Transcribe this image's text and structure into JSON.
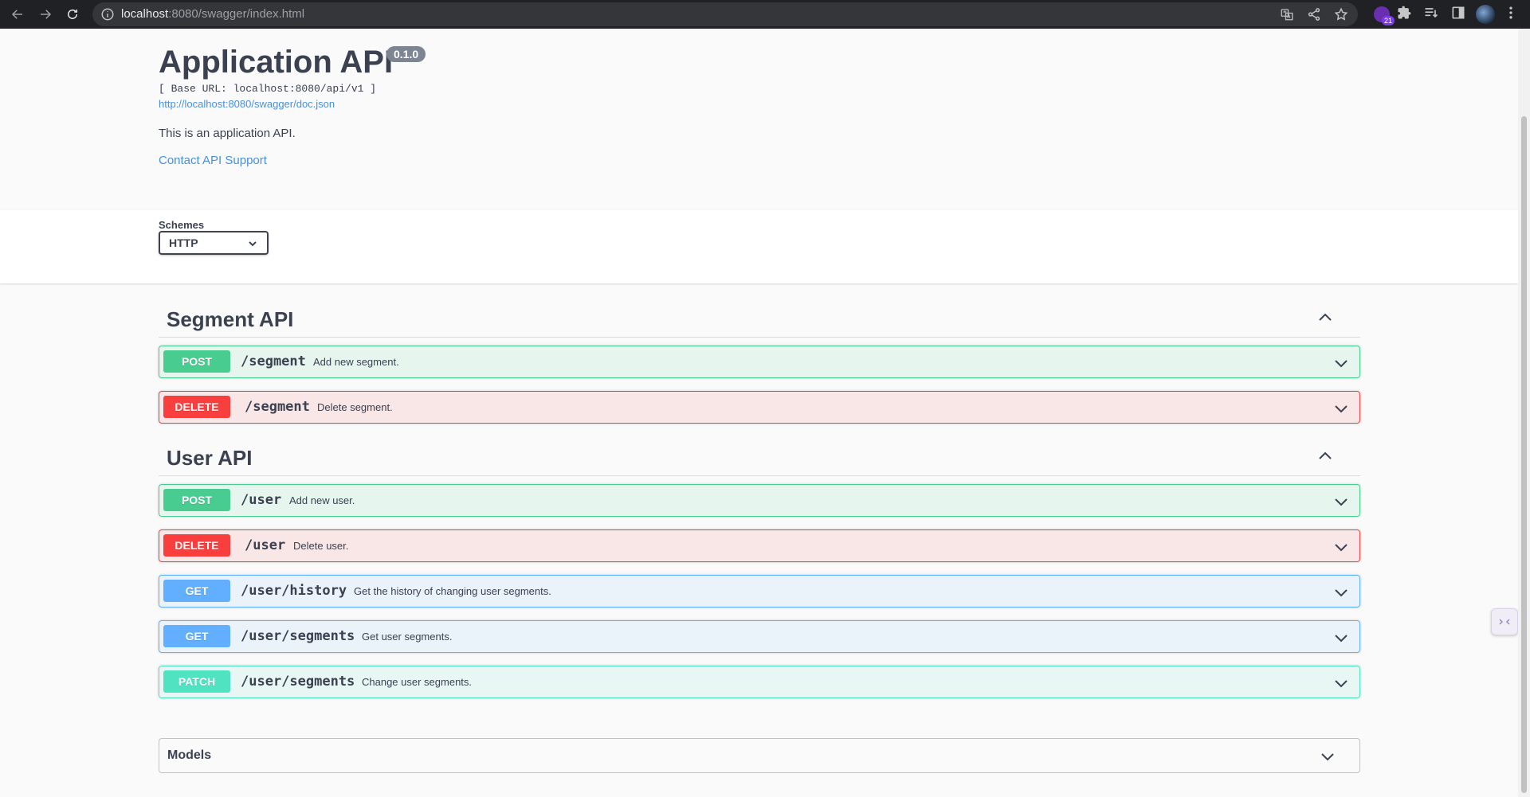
{
  "browser": {
    "url_host": "localhost",
    "url_rest": ":8080/swagger/index.html",
    "extension_badge": "21"
  },
  "info": {
    "title": "Application API",
    "version": "0.1.0",
    "base_url": "[ Base URL: localhost:8080/api/v1 ]",
    "doc_link": "http://localhost:8080/swagger/doc.json",
    "description": "This is an application API.",
    "contact": "Contact API Support"
  },
  "schemes": {
    "label": "Schemes",
    "selected": "HTTP"
  },
  "tags": [
    {
      "name": "Segment API",
      "operations": [
        {
          "method": "POST",
          "path": "/segment",
          "summary": "Add new segment."
        },
        {
          "method": "DELETE",
          "path": "/segment",
          "summary": "Delete segment."
        }
      ]
    },
    {
      "name": "User API",
      "operations": [
        {
          "method": "POST",
          "path": "/user",
          "summary": "Add new user."
        },
        {
          "method": "DELETE",
          "path": "/user",
          "summary": "Delete user."
        },
        {
          "method": "GET",
          "path": "/user/history",
          "summary": "Get the history of changing user segments."
        },
        {
          "method": "GET",
          "path": "/user/segments",
          "summary": "Get user segments."
        },
        {
          "method": "PATCH",
          "path": "/user/segments",
          "summary": "Change user segments."
        }
      ]
    }
  ],
  "models": {
    "label": "Models"
  },
  "colors": {
    "post": "#49cc90",
    "delete": "#f93e3e",
    "get": "#61affe",
    "patch": "#50e3c2",
    "link": "#4990e2"
  }
}
